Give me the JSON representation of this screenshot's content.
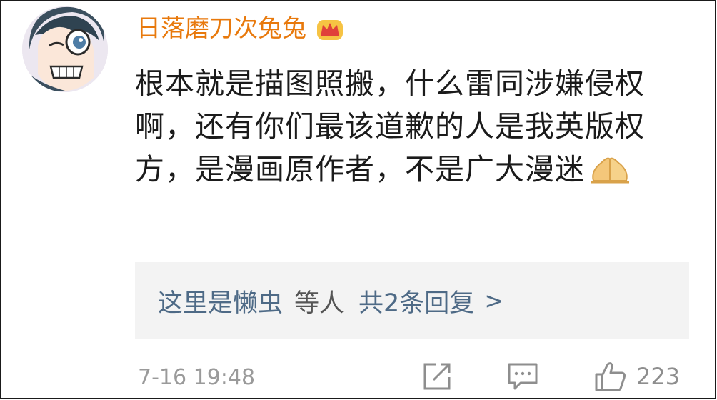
{
  "user": {
    "name": "日落磨刀次兔兔",
    "badge_icon": "crown-icon",
    "name_color": "#e8790c"
  },
  "comment": {
    "text": "根本就是描图照搬，什么雷同涉嫌侵权啊，还有你们最该道歉的人是我英版权方，是漫画原作者，不是广大漫迷",
    "emoji": "praying-hands-icon"
  },
  "replies": {
    "user": "这里是懒虫",
    "action": "等人",
    "count_label": "共2条回复",
    "chevron": ">"
  },
  "footer": {
    "timestamp": "7-16 19:48",
    "likes": "223",
    "icons": [
      "share-icon",
      "comment-icon",
      "thumbs-up-icon"
    ]
  }
}
